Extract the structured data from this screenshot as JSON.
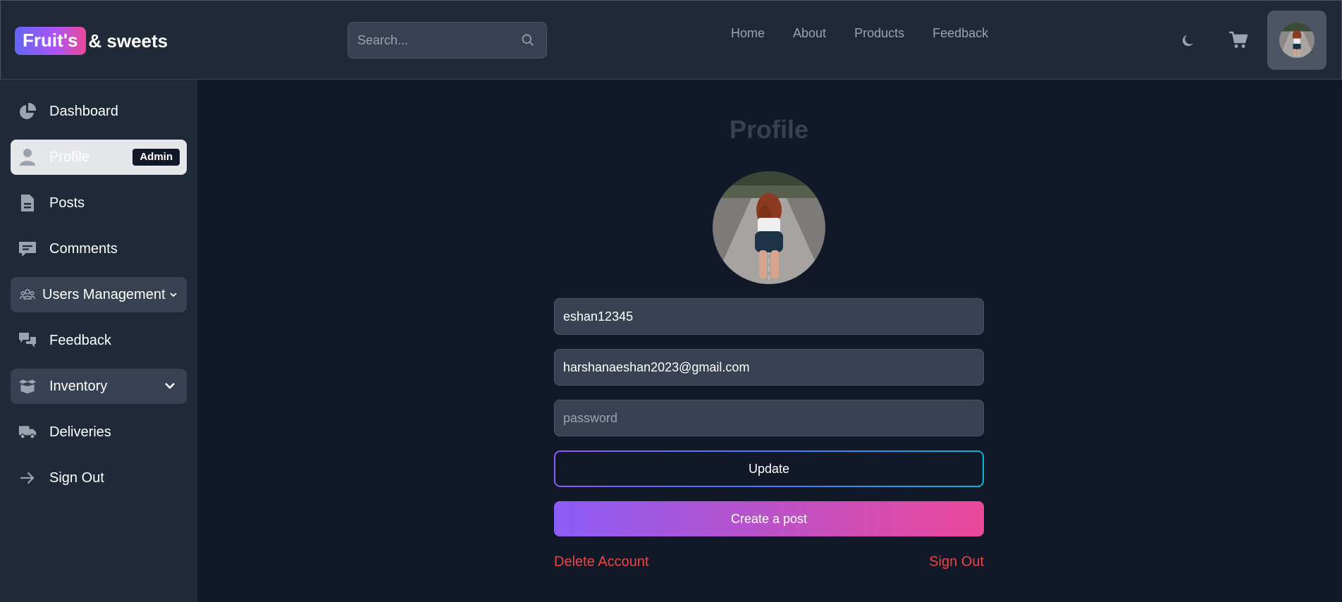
{
  "header": {
    "logo_pill": "Fruit's",
    "logo_rest": "& sweets",
    "search_placeholder": "Search...",
    "nav": [
      "Home",
      "About",
      "Products",
      "Feedback"
    ]
  },
  "sidebar": {
    "items": [
      {
        "label": "Dashboard",
        "icon": "pie-chart-icon"
      },
      {
        "label": "Profile",
        "icon": "user-icon",
        "badge": "Admin"
      },
      {
        "label": "Posts",
        "icon": "document-icon"
      },
      {
        "label": "Comments",
        "icon": "comment-icon"
      },
      {
        "label": "Users Management",
        "icon": "users-icon"
      },
      {
        "label": "Feedback",
        "icon": "chat-bubbles-icon"
      },
      {
        "label": "Inventory",
        "icon": "box-icon"
      },
      {
        "label": "Deliveries",
        "icon": "truck-icon"
      },
      {
        "label": "Sign Out",
        "icon": "arrow-right-icon"
      }
    ]
  },
  "profile": {
    "title": "Profile",
    "username": "eshan12345",
    "email": "harshanaeshan2023@gmail.com",
    "password_placeholder": "password",
    "update_label": "Update",
    "create_post_label": "Create a post",
    "delete_label": "Delete Account",
    "signout_label": "Sign Out"
  },
  "colors": {
    "background": "#111827",
    "panel": "#1f2937",
    "input": "#374151",
    "danger": "#ef4444",
    "gradient_start": "#8b5cf6",
    "gradient_end": "#ec4899"
  }
}
